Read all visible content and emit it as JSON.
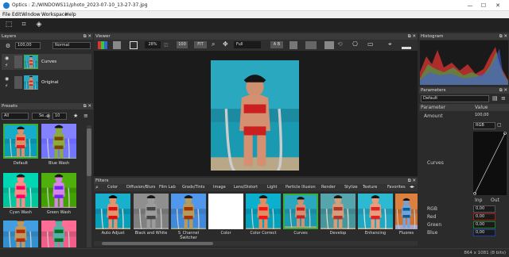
{
  "window": {
    "title": "Optics : Z:/WINDOWS11/photo_2023-07-10_13-27-37.jpg",
    "min": "—",
    "max": "☐",
    "close": "✕"
  },
  "menu": [
    "File",
    "Edit",
    "Window",
    "Workspace",
    "Help"
  ],
  "layers": {
    "title": "Layers",
    "opacity": "100,00",
    "blend": "Normal",
    "items": [
      {
        "name": "Curves"
      },
      {
        "name": "Original"
      }
    ]
  },
  "presets": {
    "title": "Presets",
    "filter": "All",
    "search": "Se...",
    "count": "10",
    "items": [
      "Default",
      "Blue Wash",
      "Cyan Wash",
      "Green Wash",
      "",
      ""
    ]
  },
  "viewer": {
    "title": "Viewer",
    "zoom": "28%",
    "zoom100": "100",
    "fit": "FIT",
    "mode": "Full",
    "ab": "A B"
  },
  "filters": {
    "title": "Filters",
    "tabs": [
      "Color",
      "Diffusion/Blurs",
      "Film Lab",
      "Grads/Tints",
      "Image",
      "Lens/Distort",
      "Light",
      "Particle Illusion",
      "Render",
      "Stylize",
      "Texture",
      "Favorites"
    ],
    "items": [
      "Auto Adjust",
      "Black and White",
      "S_Channel Switcher",
      "Color",
      "Color Correct",
      "Curves",
      "Develop",
      "Enhancing",
      "Fluores"
    ]
  },
  "histogram": {
    "title": "Histogram"
  },
  "parameters": {
    "title": "Parameters",
    "preset": "Default",
    "col_param": "Parameter",
    "col_value": "Value",
    "amount_label": "Amount",
    "amount_value": "100,00",
    "channel": "RGB",
    "curves_label": "Curves",
    "inp": "Inp",
    "out": "Out",
    "rows": [
      {
        "label": "RGB",
        "value": "0,00"
      },
      {
        "label": "Red",
        "value": "0,00"
      },
      {
        "label": "Green",
        "value": "0,00"
      },
      {
        "label": "Blue",
        "value": "0,00"
      }
    ]
  },
  "status": {
    "text": "864 x 1081 (8 bits)"
  },
  "colors": {
    "accent": "#3ab03a",
    "selected": "#3ab03a"
  }
}
